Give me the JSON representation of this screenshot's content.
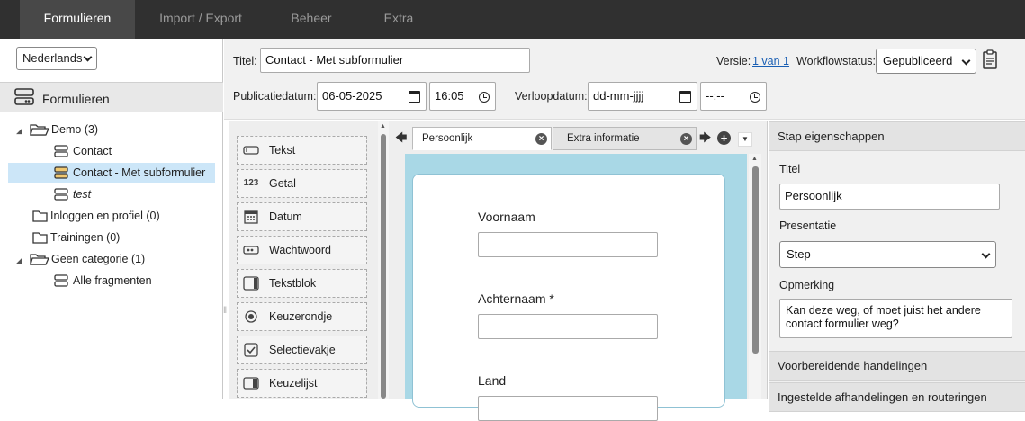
{
  "topnav": {
    "tabs": [
      "Formulieren",
      "Import / Export",
      "Beheer",
      "Extra"
    ]
  },
  "sidebar": {
    "language": "Nederlands",
    "header": "Formulieren",
    "tree": [
      {
        "label": "Demo (3)",
        "type": "folder-open"
      },
      {
        "label": "Contact",
        "type": "form"
      },
      {
        "label": "Contact - Met subformulier",
        "type": "form",
        "selected": true
      },
      {
        "label": "test",
        "type": "form",
        "italic": true
      },
      {
        "label": "Inloggen en profiel (0)",
        "type": "folder"
      },
      {
        "label": "Trainingen (0)",
        "type": "folder"
      },
      {
        "label": "Geen categorie (1)",
        "type": "folder-open"
      },
      {
        "label": "Alle fragmenten",
        "type": "form"
      }
    ]
  },
  "header": {
    "title_label": "Titel:",
    "title_value": "Contact - Met subformulier",
    "version_label": "Versie:",
    "version_link": "1 van 1",
    "workflow_label": "Workflowstatus:",
    "workflow_value": "Gepubliceerd",
    "pubdate_label": "Publicatiedatum:",
    "pubdate_value": "06-05-2025",
    "pubtime_value": "16:05",
    "expiry_label": "Verloopdatum:",
    "expiry_placeholder": "dd-mm-jjjj",
    "expiry_time_placeholder": "--:--"
  },
  "palette": {
    "items": [
      {
        "label": "Tekst",
        "icon": "text-field-icon"
      },
      {
        "label": "Getal",
        "icon": "number-icon",
        "glyph": "123"
      },
      {
        "label": "Datum",
        "icon": "calendar-icon"
      },
      {
        "label": "Wachtwoord",
        "icon": "password-icon"
      },
      {
        "label": "Tekstblok",
        "icon": "text-block-icon"
      },
      {
        "label": "Keuzerondje",
        "icon": "radio-icon"
      },
      {
        "label": "Selectievakje",
        "icon": "checkbox-icon"
      },
      {
        "label": "Keuzelijst",
        "icon": "dropdown-list-icon"
      }
    ]
  },
  "editor": {
    "tabs": [
      "Persoonlijk",
      "Extra informatie"
    ],
    "fields": [
      {
        "label": "Voornaam"
      },
      {
        "label": "Achternaam *"
      },
      {
        "label": "Land"
      }
    ]
  },
  "properties": {
    "header": "Stap eigenschappen",
    "title_label": "Titel",
    "title_value": "Persoonlijk",
    "presentation_label": "Presentatie",
    "presentation_value": "Step",
    "remark_label": "Opmerking",
    "remark_value": "Kan deze weg, of moet juist het andere contact formulier weg?",
    "section2": "Voorbereidende handelingen",
    "section3": "Ingestelde afhandelingen en routeringen"
  }
}
